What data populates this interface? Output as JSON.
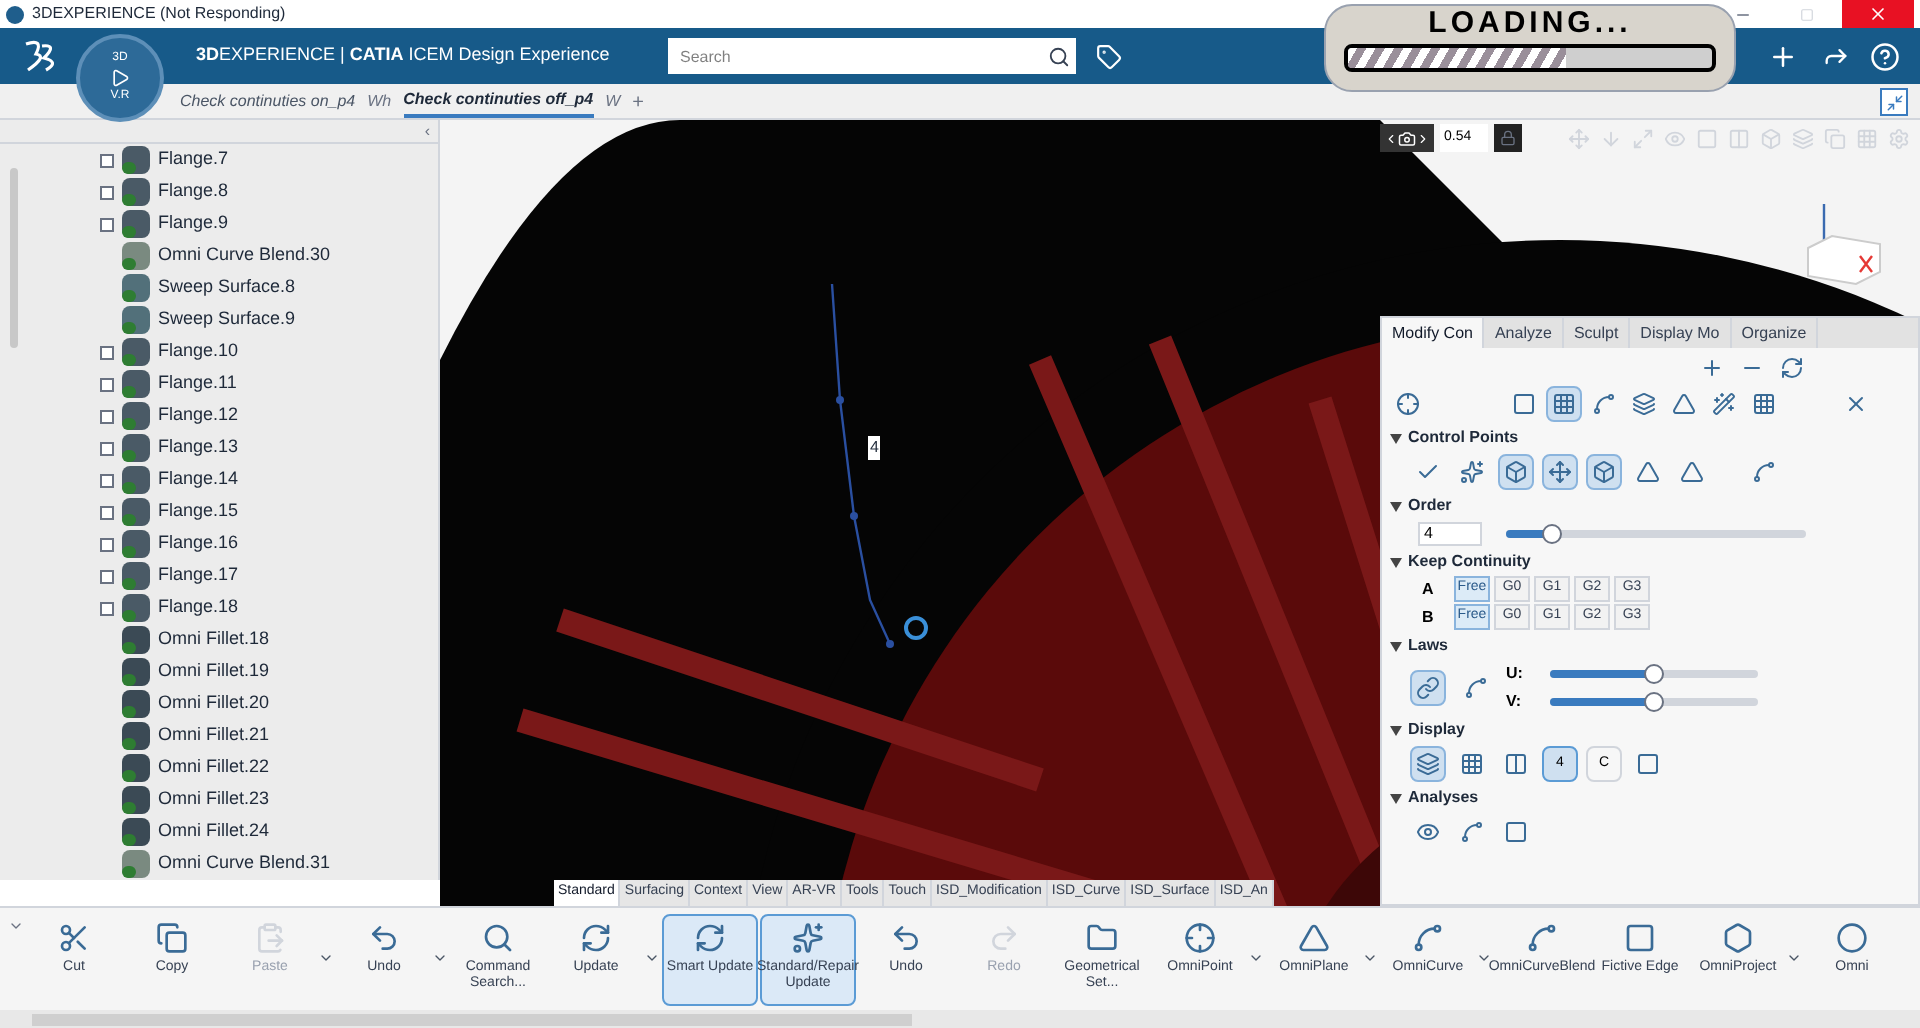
{
  "window": {
    "title": "3DEXPERIENCE (Not Responding)"
  },
  "header": {
    "app_title": "**3D**EXPERIENCE | **CATIA** ICEM Design Experience",
    "compass_top": "3D",
    "compass_bottom": "V.R",
    "search": {
      "placeholder": "Search"
    }
  },
  "loading_sticker": {
    "text": "LOADING...",
    "level": 0.6
  },
  "tabs": [
    {
      "label": "Check continuties on_p4",
      "kind": "tab",
      "selected": false
    },
    {
      "label": "Wh",
      "kind": "faded",
      "selected": false
    },
    {
      "label": "Check continuties off_p4",
      "kind": "tab",
      "selected": true
    },
    {
      "label": "W",
      "kind": "faded",
      "selected": false
    },
    {
      "label": "+",
      "kind": "add",
      "selected": false
    }
  ],
  "viewport": {
    "zoom_value": "0.54",
    "curve_label": "4"
  },
  "tree": {
    "collapse": "‹",
    "items": [
      {
        "label": "Flange.7",
        "kind": "flange",
        "expandable": true
      },
      {
        "label": "Flange.8",
        "kind": "flange",
        "expandable": true
      },
      {
        "label": "Flange.9",
        "kind": "flange",
        "expandable": true
      },
      {
        "label": "Omni Curve Blend.30",
        "kind": "blend",
        "expandable": false
      },
      {
        "label": "Sweep Surface.8",
        "kind": "sweep",
        "expandable": false
      },
      {
        "label": "Sweep Surface.9",
        "kind": "sweep",
        "expandable": false
      },
      {
        "label": "Flange.10",
        "kind": "flange",
        "expandable": true
      },
      {
        "label": "Flange.11",
        "kind": "flange",
        "expandable": true
      },
      {
        "label": "Flange.12",
        "kind": "flange",
        "expandable": true
      },
      {
        "label": "Flange.13",
        "kind": "flange",
        "expandable": true
      },
      {
        "label": "Flange.14",
        "kind": "flange",
        "expandable": true
      },
      {
        "label": "Flange.15",
        "kind": "flange",
        "expandable": true
      },
      {
        "label": "Flange.16",
        "kind": "flange",
        "expandable": true
      },
      {
        "label": "Flange.17",
        "kind": "flange",
        "expandable": true
      },
      {
        "label": "Flange.18",
        "kind": "flange",
        "expandable": true
      },
      {
        "label": "Omni Fillet.18",
        "kind": "fillet",
        "expandable": false
      },
      {
        "label": "Omni Fillet.19",
        "kind": "fillet",
        "expandable": false
      },
      {
        "label": "Omni Fillet.20",
        "kind": "fillet",
        "expandable": false
      },
      {
        "label": "Omni Fillet.21",
        "kind": "fillet",
        "expandable": false
      },
      {
        "label": "Omni Fillet.22",
        "kind": "fillet",
        "expandable": false
      },
      {
        "label": "Omni Fillet.23",
        "kind": "fillet",
        "expandable": false
      },
      {
        "label": "Omni Fillet.24",
        "kind": "fillet",
        "expandable": false
      },
      {
        "label": "Omni Curve Blend.31",
        "kind": "blend",
        "expandable": false
      }
    ]
  },
  "panel": {
    "tabs": [
      {
        "label": "Modify Con",
        "selected": true
      },
      {
        "label": "Analyze",
        "selected": false
      },
      {
        "label": "Sculpt",
        "selected": false
      },
      {
        "label": "Display Mo",
        "selected": false
      },
      {
        "label": "Organize",
        "selected": false
      }
    ],
    "sections": {
      "control_points": "Control Points",
      "order": "Order",
      "keep_continuity": "Keep Continuity",
      "laws": "Laws",
      "display": "Display",
      "analyses": "Analyses"
    },
    "order": {
      "value": "4",
      "level": 0.15
    },
    "continuity": [
      {
        "label": "A",
        "options": [
          {
            "label": "Free",
            "selected": true
          },
          {
            "label": "G0",
            "selected": false
          },
          {
            "label": "G1",
            "selected": false
          },
          {
            "label": "G2",
            "selected": false
          },
          {
            "label": "G3",
            "selected": false
          }
        ]
      },
      {
        "label": "B",
        "options": [
          {
            "label": "Free",
            "selected": true
          },
          {
            "label": "G0",
            "selected": false
          },
          {
            "label": "G1",
            "selected": false
          },
          {
            "label": "G2",
            "selected": false
          },
          {
            "label": "G3",
            "selected": false
          }
        ]
      }
    ],
    "laws": [
      {
        "label": "U:",
        "level": 0.5
      },
      {
        "label": "V:",
        "level": 0.5
      }
    ],
    "display_buttons": [
      {
        "label": "4",
        "selected": true
      },
      {
        "label": "C",
        "selected": false
      }
    ]
  },
  "toolbar_tabs": [
    {
      "label": "Standard",
      "selected": true
    },
    {
      "label": "Surfacing",
      "selected": false
    },
    {
      "label": "Context",
      "selected": false
    },
    {
      "label": "View",
      "selected": false
    },
    {
      "label": "AR-VR",
      "selected": false
    },
    {
      "label": "Tools",
      "selected": false
    },
    {
      "label": "Touch",
      "selected": false
    },
    {
      "label": "ISD_Modification",
      "selected": false
    },
    {
      "label": "ISD_Curve",
      "selected": false
    },
    {
      "label": "ISD_Surface",
      "selected": false
    },
    {
      "label": "ISD_An",
      "selected": false
    }
  ],
  "toolbar": [
    {
      "label": "Cut",
      "dropdown": false,
      "disabled": false,
      "selected": false
    },
    {
      "label": "Copy",
      "dropdown": false,
      "disabled": false,
      "selected": false
    },
    {
      "label": "Paste",
      "dropdown": true,
      "disabled": true,
      "selected": false
    },
    {
      "label": "Undo",
      "dropdown": true,
      "disabled": false,
      "selected": false
    },
    {
      "label": "Command Search...",
      "dropdown": false,
      "disabled": false,
      "selected": false
    },
    {
      "label": "Update",
      "dropdown": true,
      "disabled": false,
      "selected": false
    },
    {
      "label": "Smart Update",
      "dropdown": false,
      "disabled": false,
      "selected": true
    },
    {
      "label": "Standard/Repair Update",
      "dropdown": false,
      "disabled": false,
      "selected": true
    },
    {
      "label": "Undo",
      "dropdown": false,
      "disabled": false,
      "selected": false
    },
    {
      "label": "Redo",
      "dropdown": false,
      "disabled": true,
      "selected": false
    },
    {
      "label": "Geometrical Set...",
      "dropdown": false,
      "disabled": false,
      "selected": false
    },
    {
      "label": "OmniPoint",
      "dropdown": true,
      "disabled": false,
      "selected": false
    },
    {
      "label": "OmniPlane",
      "dropdown": true,
      "disabled": false,
      "selected": false
    },
    {
      "label": "OmniCurve",
      "dropdown": true,
      "disabled": false,
      "selected": false
    },
    {
      "label": "OmniCurveBlend",
      "dropdown": false,
      "disabled": false,
      "selected": false
    },
    {
      "label": "Fictive Edge",
      "dropdown": false,
      "disabled": false,
      "selected": false
    },
    {
      "label": "OmniProject",
      "dropdown": true,
      "disabled": false,
      "selected": false
    },
    {
      "label": "Omni",
      "dropdown": false,
      "disabled": false,
      "selected": false
    }
  ]
}
